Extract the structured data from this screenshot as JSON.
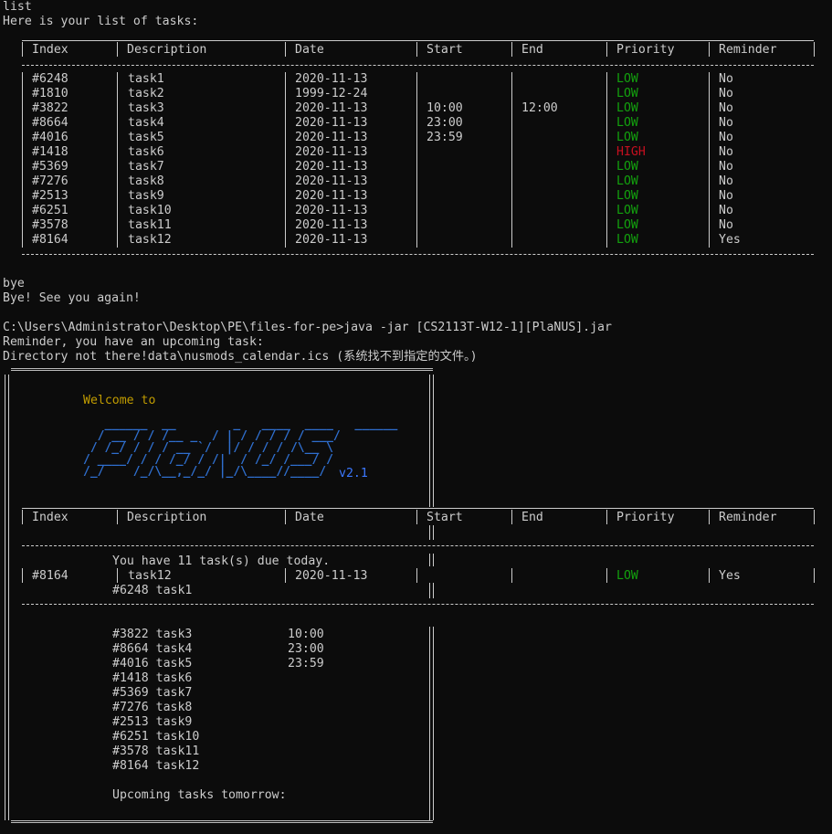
{
  "terminal": {
    "cmd_list": "list",
    "list_header": "Here is your list of tasks:",
    "cmd_bye": "bye",
    "bye_msg": "Bye! See you again!",
    "prompt_cmd": "C:\\Users\\Administrator\\Desktop\\PE\\files-for-pe>java -jar [CS2113T-W12-1][PlaNUS].jar",
    "reminder_msg": "Reminder, you have an upcoming task:",
    "error_msg": "Directory not there!data\\nusmods_calendar.ics (系统找不到指定的文件。)"
  },
  "table": {
    "headers": [
      "Index",
      "Description",
      "Date",
      "Start",
      "End",
      "Priority",
      "Reminder"
    ],
    "rows": [
      {
        "index": "#6248",
        "desc": "task1",
        "date": "2020-11-13",
        "start": "",
        "end": "",
        "priority": "LOW",
        "reminder": "No"
      },
      {
        "index": "#1810",
        "desc": "task2",
        "date": "1999-12-24",
        "start": "",
        "end": "",
        "priority": "LOW",
        "reminder": "No"
      },
      {
        "index": "#3822",
        "desc": "task3",
        "date": "2020-11-13",
        "start": "10:00",
        "end": "12:00",
        "priority": "LOW",
        "reminder": "No"
      },
      {
        "index": "#8664",
        "desc": "task4",
        "date": "2020-11-13",
        "start": "23:00",
        "end": "",
        "priority": "LOW",
        "reminder": "No"
      },
      {
        "index": "#4016",
        "desc": "task5",
        "date": "2020-11-13",
        "start": "23:59",
        "end": "",
        "priority": "LOW",
        "reminder": "No"
      },
      {
        "index": "#1418",
        "desc": "task6",
        "date": "2020-11-13",
        "start": "",
        "end": "",
        "priority": "HIGH",
        "reminder": "No"
      },
      {
        "index": "#5369",
        "desc": "task7",
        "date": "2020-11-13",
        "start": "",
        "end": "",
        "priority": "LOW",
        "reminder": "No"
      },
      {
        "index": "#7276",
        "desc": "task8",
        "date": "2020-11-13",
        "start": "",
        "end": "",
        "priority": "LOW",
        "reminder": "No"
      },
      {
        "index": "#2513",
        "desc": "task9",
        "date": "2020-11-13",
        "start": "",
        "end": "",
        "priority": "LOW",
        "reminder": "No"
      },
      {
        "index": "#6251",
        "desc": "task10",
        "date": "2020-11-13",
        "start": "",
        "end": "",
        "priority": "LOW",
        "reminder": "No"
      },
      {
        "index": "#3578",
        "desc": "task11",
        "date": "2020-11-13",
        "start": "",
        "end": "",
        "priority": "LOW",
        "reminder": "No"
      },
      {
        "index": "#8164",
        "desc": "task12",
        "date": "2020-11-13",
        "start": "",
        "end": "",
        "priority": "LOW",
        "reminder": "Yes"
      }
    ]
  },
  "banner": {
    "welcome": "Welcome to",
    "logo_lines": [
      "   ______  __        _   ____  ____   ______",
      "  / __ / / /__ _  / | / / / / / ___/",
      " / /_/ / / / __ `/  |/ / / / /\\__ \\",
      "/ ____/ / / /_/ / /|  / /_/ /___/ /",
      "/_/    /_/\\__,_/_/ |_/\\____//____/"
    ],
    "version": "v2.1"
  },
  "upcoming_row": {
    "index": "#8164",
    "desc": "task12",
    "date": "2020-11-13",
    "priority": "LOW",
    "reminder": "Yes"
  },
  "today": {
    "heading": "You have 11 task(s) due today.",
    "items": [
      {
        "label": "#6248 task1",
        "time": ""
      },
      {
        "label": "#3822 task3",
        "time": "10:00"
      },
      {
        "label": "#8664 task4",
        "time": "23:00"
      },
      {
        "label": "#4016 task5",
        "time": "23:59"
      },
      {
        "label": "#1418 task6",
        "time": ""
      },
      {
        "label": "#5369 task7",
        "time": ""
      },
      {
        "label": "#7276 task8",
        "time": ""
      },
      {
        "label": "#2513 task9",
        "time": ""
      },
      {
        "label": "#6251 task10",
        "time": ""
      },
      {
        "label": "#3578 task11",
        "time": ""
      },
      {
        "label": "#8164 task12",
        "time": ""
      }
    ],
    "tomorrow_heading": "Upcoming tasks tomorrow:"
  },
  "colors": {
    "background": "#0c0c0c",
    "text": "#cccccc",
    "low": "#13a10e",
    "high": "#c50f1f",
    "welcome": "#c19c00",
    "logo": "#2f6fcf"
  }
}
